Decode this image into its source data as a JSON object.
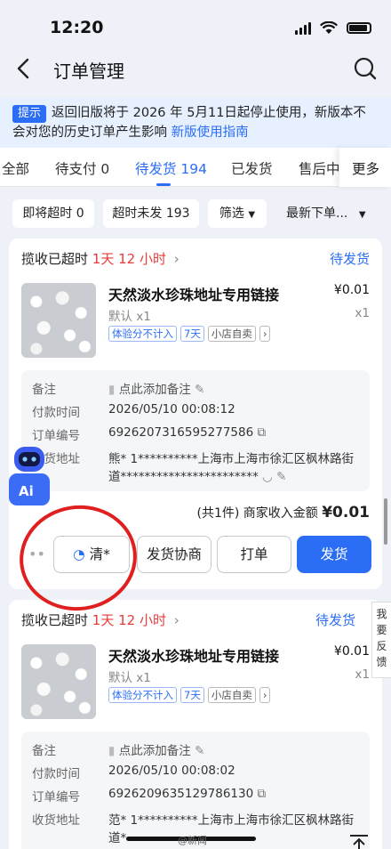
{
  "status": {
    "time": "12:20"
  },
  "nav": {
    "title": "订单管理"
  },
  "notice": {
    "tag": "提示",
    "text": "返回旧版将于 2026 年 5月11日起停止使用，新版本不会对您的历史订单产生影响",
    "link": "新版使用指南"
  },
  "tabs": [
    {
      "label": "全部"
    },
    {
      "label": "待支付 0"
    },
    {
      "label": "待发货 194"
    },
    {
      "label": "已发货"
    },
    {
      "label": "售后中"
    }
  ],
  "tabs_more": "更多",
  "filters": {
    "chip1": "即将超时 0",
    "chip2": "超时未发 193",
    "chip3": "筛选",
    "sort": "最新下单..."
  },
  "orders": [
    {
      "head_prefix": "揽收已超时",
      "head_time": "1天 12 小时",
      "status": "待发货",
      "title": "天然淡水珍珠地址专用链接",
      "price": "¥0.01",
      "spec": "默认 x1",
      "qty": "x1",
      "tags": [
        "体验分不计入",
        "7天",
        "小店自卖"
      ],
      "remark_label": "备注",
      "remark_value": "点此添加备注",
      "paytime_label": "付款时间",
      "paytime": "2026/05/10 00:08:12",
      "orderno_label": "订单编号",
      "orderno": "6926207316595277586",
      "addr_label": "收货地址",
      "addr_line1": "熊* 1**********上海市上海市徐汇区枫林路街",
      "addr_line2": "道***********************",
      "summary_prefix": "(共1件) 商家收入金额",
      "summary_amount": "¥0.01",
      "btn_chat": "清*",
      "btn_negotiate": "发货协商",
      "btn_print": "打单",
      "btn_ship": "发货"
    },
    {
      "head_prefix": "揽收已超时",
      "head_time": "1天 12 小时",
      "status": "待发货",
      "title": "天然淡水珍珠地址专用链接",
      "price": "¥0.01",
      "spec": "默认 x1",
      "qty": "x1",
      "tags": [
        "体验分不计入",
        "7天",
        "小店自卖"
      ],
      "remark_label": "备注",
      "remark_value": "点此添加备注",
      "paytime_label": "付款时间",
      "paytime": "2026/05/10 00:08:02",
      "orderno_label": "订单编号",
      "orderno": "6926209635129786130",
      "addr_label": "收货地址",
      "addr_line1": "范* 1**********上海市上海市徐汇区枫林路街",
      "addr_line2": "道*"
    }
  ],
  "feedback": "我要反馈",
  "watermark": "@新闻"
}
